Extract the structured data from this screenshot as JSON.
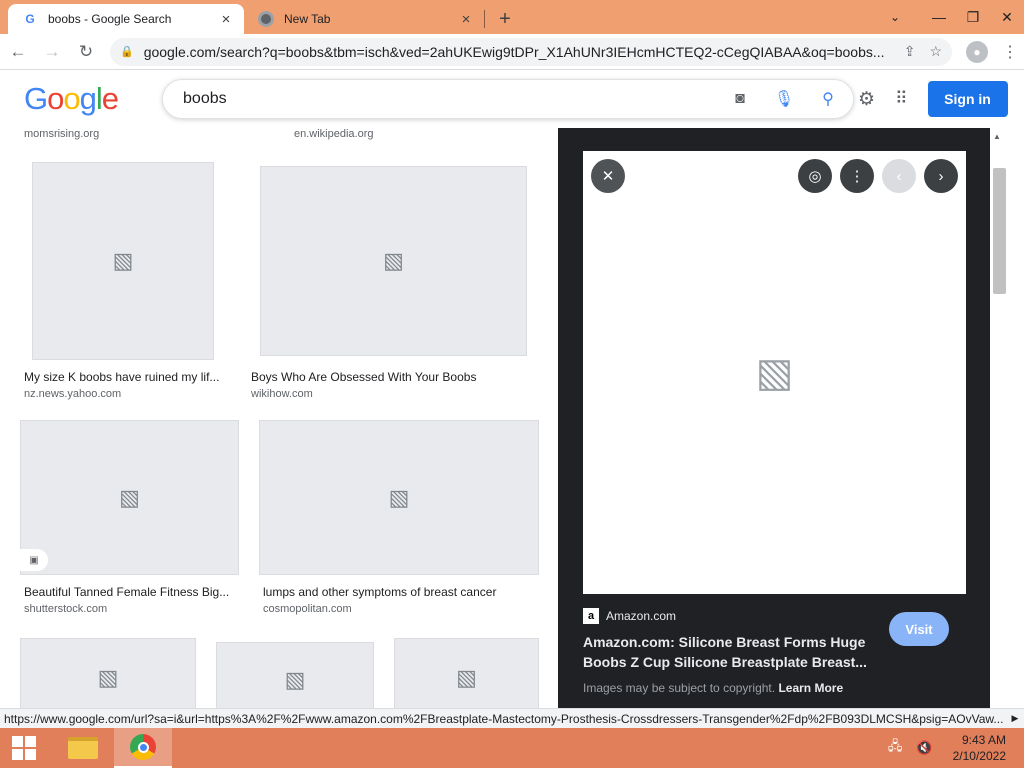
{
  "browser": {
    "tabs": [
      {
        "title": "boobs - Google Search",
        "favicon": "google-favicon",
        "active": true
      },
      {
        "title": "New Tab",
        "favicon": "chrome-favicon",
        "active": false
      }
    ],
    "new_tab_glyph": "+",
    "window_controls": {
      "tab_list": "⌄",
      "minimize": "—",
      "restore": "❐",
      "close": "✕"
    },
    "url": "google.com/search?q=boobs&tbm=isch&ved=2ahUKEwig9tDPr_X1AhUNr3IEHcmHCTEQ2-cCegQIABAA&oq=boobs..."
  },
  "google": {
    "logo": [
      "G",
      "o",
      "o",
      "g",
      "l",
      "e"
    ],
    "query": "boobs",
    "sign_in": "Sign in"
  },
  "results": {
    "top_sources": [
      "momsrising.org",
      "en.wikipedia.org"
    ],
    "tiles": [
      {
        "caption": "My size K boobs have ruined my lif...",
        "site": "nz.news.yahoo.com"
      },
      {
        "caption": "Boys Who Are Obsessed With Your Boobs",
        "site": "wikihow.com"
      },
      {
        "caption": "Beautiful Tanned Female Fitness Big...",
        "site": "shutterstock.com"
      },
      {
        "caption": "lumps and other symptoms of breast cancer",
        "site": "cosmopolitan.com"
      }
    ]
  },
  "preview": {
    "site": "Amazon.com",
    "site_favicon": "a",
    "title": "Amazon.com: Silicone Breast Forms Huge Boobs Z Cup Silicone Breastplate Breast...",
    "visit": "Visit",
    "copyright_prefix": "Images may be subject to copyright.",
    "learn_more": "Learn More"
  },
  "status_url": "https://www.google.com/url?sa=i&url=https%3A%2F%2Fwww.amazon.com%2FBreastplate-Mastectomy-Prosthesis-Crossdressers-Transgender%2Fdp%2FB093DLMCSH&psig=AOvVaw...",
  "taskbar": {
    "time": "9:43 AM",
    "date": "2/10/2022"
  },
  "colors": {
    "tabstrip": "#f0a070",
    "taskbar": "#e07f5a",
    "google_blue": "#1a73e8",
    "preview_bg": "#202124"
  }
}
